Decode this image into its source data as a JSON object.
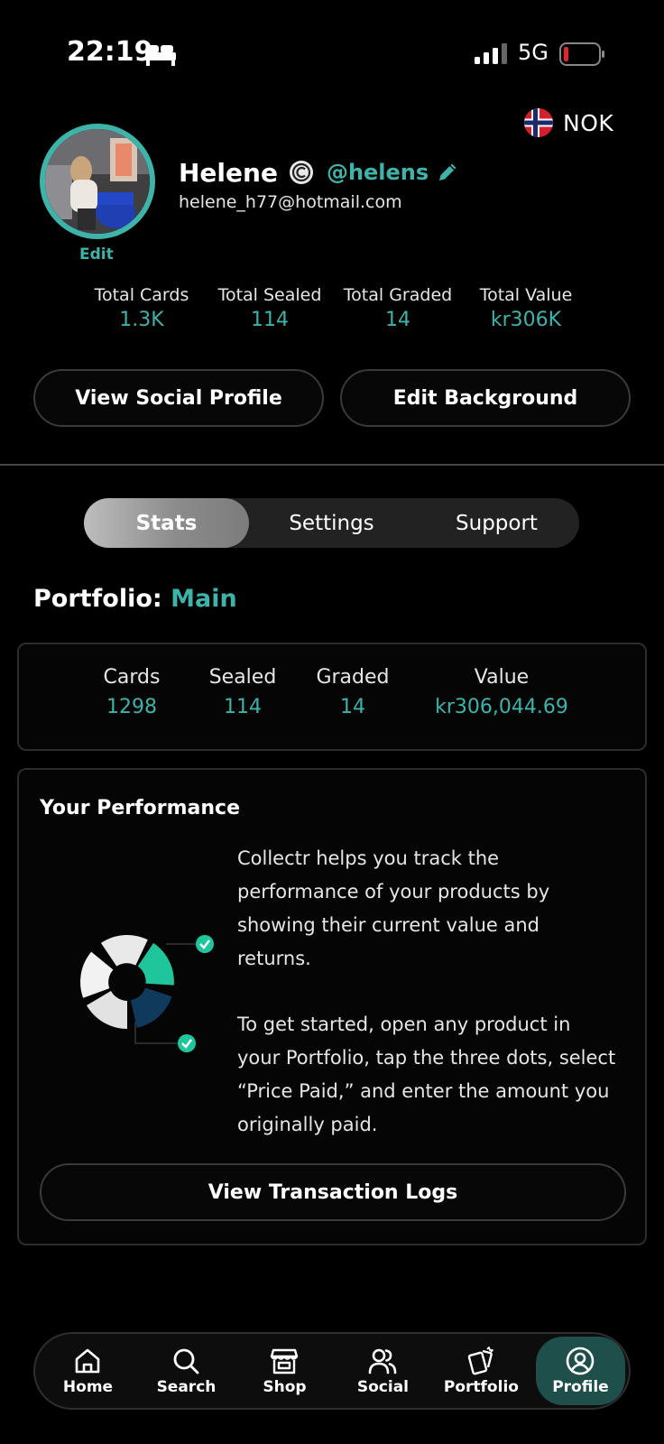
{
  "status_bar": {
    "time": "22:19",
    "network": "5G",
    "icons": [
      "bed-icon",
      "signal-icon",
      "battery-icon"
    ]
  },
  "currency": {
    "code": "NOK",
    "icon": "norway-flag-icon"
  },
  "profile": {
    "name": "Helene",
    "handle": "@helens",
    "email": "helene_h77@hotmail.com",
    "edit_label": "Edit"
  },
  "totals": [
    {
      "label": "Total Cards",
      "value": "1.3K"
    },
    {
      "label": "Total Sealed",
      "value": "114"
    },
    {
      "label": "Total Graded",
      "value": "14"
    },
    {
      "label": "Total Value",
      "value": "kr306K"
    }
  ],
  "buttons": {
    "view_social_profile": "View Social Profile",
    "edit_background": "Edit Background",
    "view_transaction_logs": "View Transaction Logs"
  },
  "segments": [
    {
      "label": "Stats",
      "active": true
    },
    {
      "label": "Settings",
      "active": false
    },
    {
      "label": "Support",
      "active": false
    }
  ],
  "portfolio": {
    "label": "Portfolio:",
    "name": "Main",
    "stats": [
      {
        "label": "Cards",
        "value": "1298"
      },
      {
        "label": "Sealed",
        "value": "114"
      },
      {
        "label": "Graded",
        "value": "14"
      },
      {
        "label": "Value",
        "value": "kr306,044.69"
      }
    ]
  },
  "performance": {
    "title": "Your Performance",
    "paragraph1": "Collectr helps you track the performance of your products by showing their current value and returns.",
    "paragraph2": "To get started, open any product in your Portfolio, tap the three dots, select “Price Paid,” and enter the amount you originally paid."
  },
  "tabs": [
    {
      "label": "Home",
      "icon": "home-icon",
      "active": false
    },
    {
      "label": "Search",
      "icon": "search-icon",
      "active": false
    },
    {
      "label": "Shop",
      "icon": "shop-icon",
      "active": false
    },
    {
      "label": "Social",
      "icon": "social-icon",
      "active": false
    },
    {
      "label": "Portfolio",
      "icon": "portfolio-icon",
      "active": false
    },
    {
      "label": "Profile",
      "icon": "profile-icon",
      "active": true
    }
  ],
  "colors": {
    "accent": "#3db3aa",
    "background": "#000000",
    "active_tab": "#1f4f4b"
  }
}
